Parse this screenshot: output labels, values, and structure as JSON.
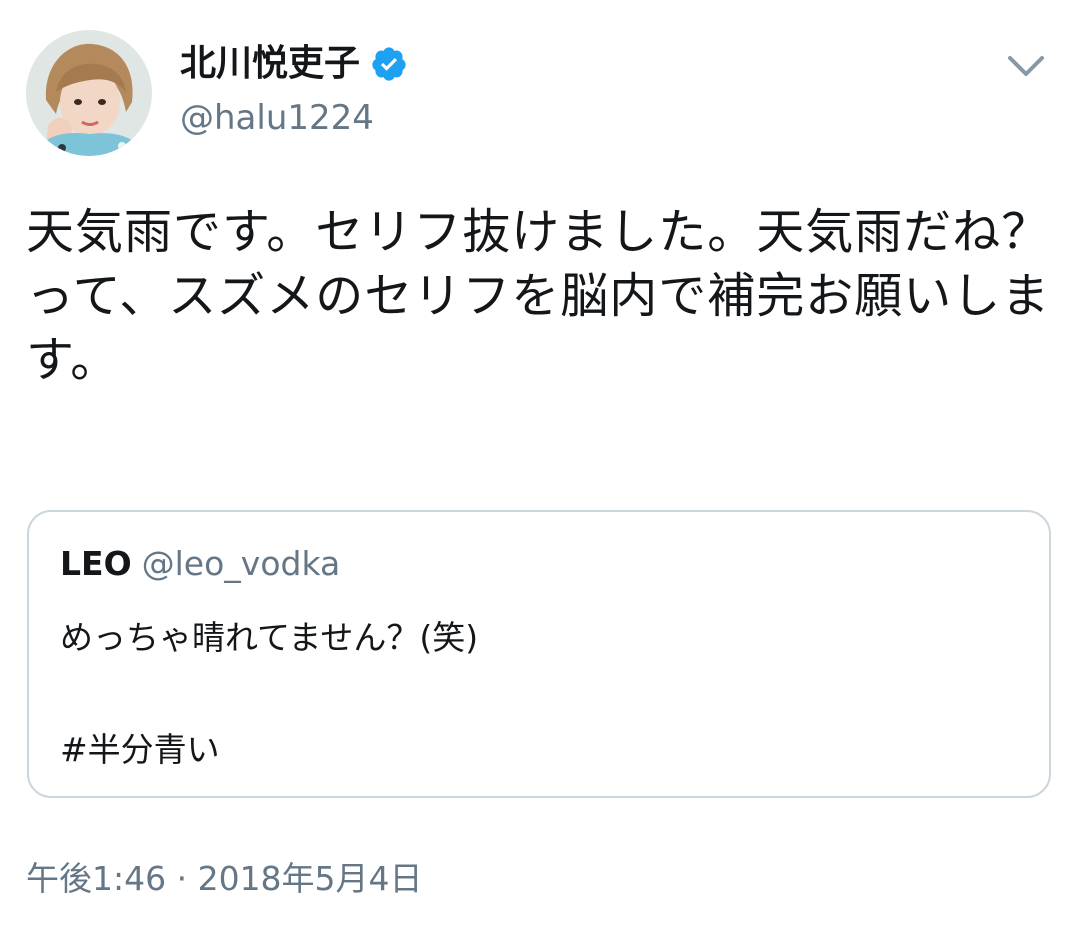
{
  "author": {
    "display_name": "北川悦吏子",
    "handle": "@halu1224",
    "verified": true,
    "avatar": "avatar-photo"
  },
  "tweet": {
    "text": "天気雨です。セリフ抜けました。天気雨だね？って、スズメのセリフを脳内で補完お願いします。"
  },
  "quoted_tweet": {
    "display_name": "LEO",
    "handle": "@leo_vodka",
    "text": "めっちゃ晴れてません？(笑)",
    "hashtag": "#半分青い"
  },
  "timestamp": "午後1:46 · 2018年5月4日",
  "icons": {
    "verified": "verified-badge-icon",
    "menu": "chevron-down-icon"
  },
  "colors": {
    "verified_blue": "#1da1f2",
    "secondary_text": "#657786",
    "border": "#ccd6dd",
    "primary_text": "#14171a"
  }
}
